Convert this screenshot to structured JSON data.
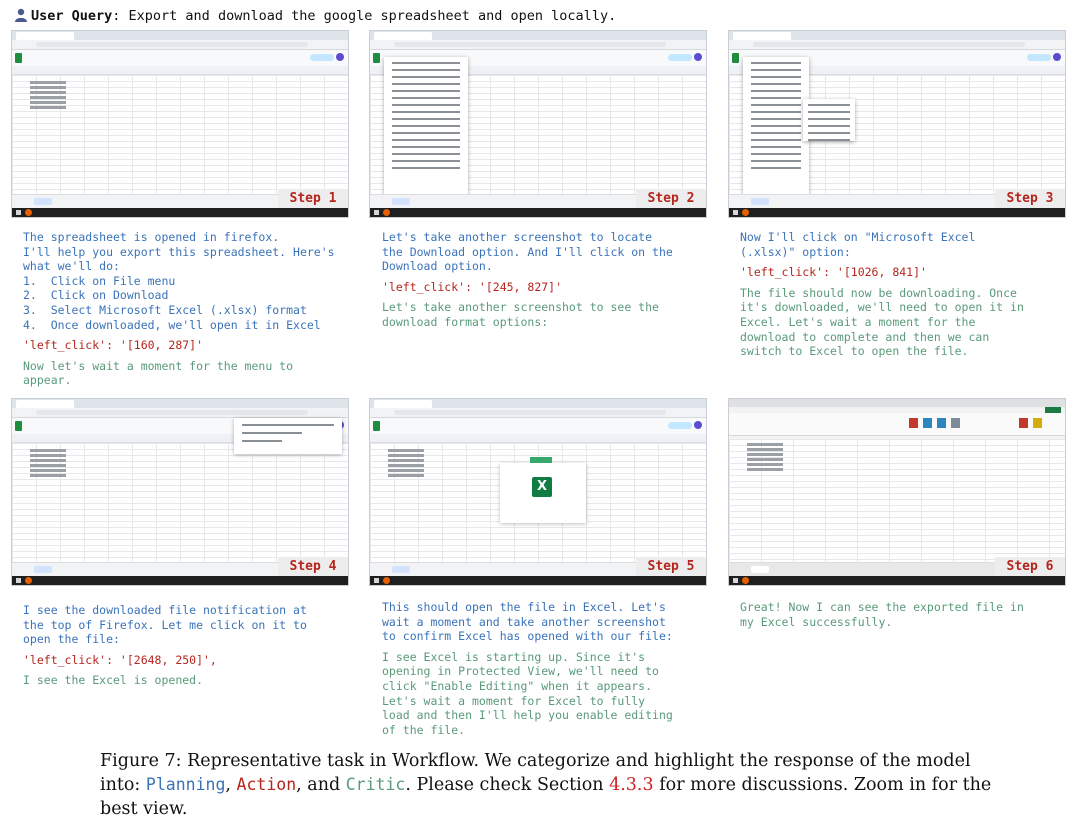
{
  "query": {
    "label": "User Query",
    "text": ": Export and download the google spreadsheet and open locally."
  },
  "colors": {
    "planning": "#3a73b9",
    "action": "#b5251d",
    "critic": "#5a9a79",
    "step_label": "#b5251d"
  },
  "steps": [
    {
      "label": "Step 1",
      "planning": "The spreadsheet is opened in firefox.\nI'll help you export this spreadsheet. Here's\nwhat we'll do:\n1.  Click on File menu\n2.  Click on Download\n3.  Select Microsoft Excel (.xlsx) format\n4.  Once downloaded, we'll open it in Excel",
      "action": "'left_click': '[160, 287]'",
      "critic": "Now let's wait a moment for the menu to\nappear."
    },
    {
      "label": "Step 2",
      "planning": "Let's take another screenshot to locate\nthe Download option. And I'll click on the\nDownload option.",
      "action": "'left_click': '[245, 827]'",
      "critic": "Let's take another screenshot to see the\ndownload format options:"
    },
    {
      "label": "Step 3",
      "planning": "Now I'll click on \"Microsoft Excel\n(.xlsx)\" option:",
      "action": "'left_click': '[1026, 841]'",
      "critic": "The file should now be downloading. Once\nit's downloaded, we'll need to open it in\nExcel. Let's wait a moment for the\ndownload to complete and then we can\nswitch to Excel to open the file."
    },
    {
      "label": "Step 4",
      "planning": "I see the downloaded file notification at\nthe top of Firefox. Let me click on it to\nopen the file:",
      "action": "'left_click': '[2648, 250]',",
      "critic": "I see the Excel is opened."
    },
    {
      "label": "Step 5",
      "planning": "This should open the file in Excel. Let's\nwait a moment and take another screenshot\nto confirm Excel has opened with our file:",
      "action": "",
      "critic": "I see Excel is starting up. Since it's\nopening in Protected View, we'll need to\nclick \"Enable Editing\" when it appears.\nLet's wait a moment for Excel to fully\nload and then I'll help you enable editing\nof the file."
    },
    {
      "label": "Step 6",
      "planning": "Great! Now I can see the exported file in\nmy Excel successfully.",
      "action": "",
      "critic": ""
    }
  ],
  "caption": {
    "prefix": "Figure 7: Representative task in Workflow. We categorize and highlight the response of the model into: ",
    "planning": "Planning",
    "sep1": ", ",
    "action": "Action",
    "sep2": ", and ",
    "critic": "Critic",
    "mid": ". Please check Section ",
    "ref": "4.3.3",
    "suffix": " for more discussions. Zoom in for the best view."
  }
}
